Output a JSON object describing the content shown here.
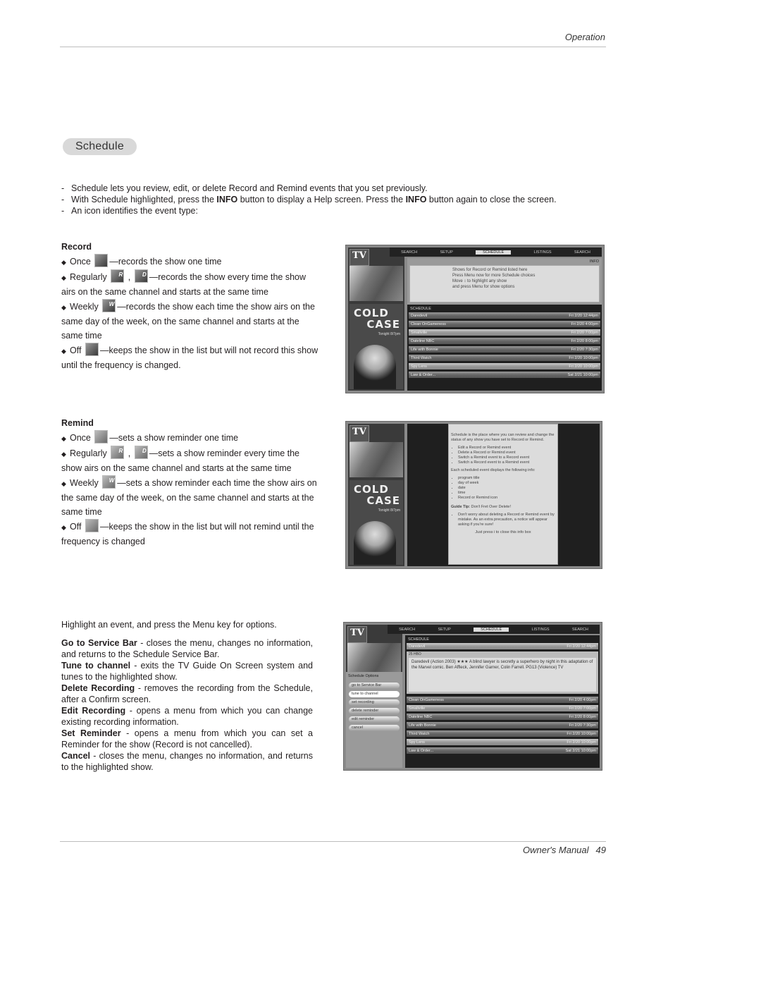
{
  "header": {
    "section_label": "Operation"
  },
  "title_pill": "Schedule",
  "intro": [
    {
      "parts": [
        {
          "t": "Schedule lets you review, edit, or delete Record and Remind events that you set previously."
        }
      ]
    },
    {
      "parts": [
        {
          "t": "With Schedule highlighted, press the "
        },
        {
          "t": "INFO",
          "b": true
        },
        {
          "t": " button to display a Help screen. Press the "
        },
        {
          "t": "INFO",
          "b": true
        },
        {
          "t": " button again to close the screen."
        }
      ]
    },
    {
      "parts": [
        {
          "t": "An icon identifies the event type:"
        }
      ]
    }
  ],
  "record": {
    "heading": "Record",
    "items": [
      {
        "label": "Once",
        "icons": [
          "record-once"
        ],
        "icon_letters": [
          ""
        ],
        "text": "—records the show one time"
      },
      {
        "label": "Regularly",
        "icons": [
          "record-regular-r",
          "record-regular-d"
        ],
        "icon_letters": [
          "R",
          "D"
        ],
        "text": "—records the show every time the show airs on the same channel and starts at the same time"
      },
      {
        "label": "Weekly",
        "icons": [
          "record-weekly"
        ],
        "icon_letters": [
          "W"
        ],
        "text": "—records the show each time the show airs on the same day of the week, on the same channel and starts at the same time"
      },
      {
        "label": "Off",
        "icons": [
          "record-off"
        ],
        "icon_letters": [
          ""
        ],
        "text": "—keeps the show in the list but will not record this show until the frequency is changed."
      }
    ]
  },
  "remind": {
    "heading": "Remind",
    "items": [
      {
        "label": "Once",
        "icons": [
          "remind-once"
        ],
        "icon_letters": [
          ""
        ],
        "text": "—sets a show reminder one time"
      },
      {
        "label": "Regularly",
        "icons": [
          "remind-regular-r",
          "remind-regular-d"
        ],
        "icon_letters": [
          "R",
          "D"
        ],
        "text": "—sets a show reminder every time the show airs on the same channel and starts at the same time"
      },
      {
        "label": "Weekly",
        "icons": [
          "remind-weekly"
        ],
        "icon_letters": [
          "W"
        ],
        "text": "—sets a show reminder each time the show airs on the same day of the week, on the same channel and starts at the same time"
      },
      {
        "label": "Off",
        "icons": [
          "remind-off"
        ],
        "icon_letters": [
          ""
        ],
        "text": "—keeps the show in the list but will not remind until the frequency is changed"
      }
    ]
  },
  "options": {
    "lead": "Highlight an event, and press the Menu key for options.",
    "items": [
      {
        "term": "Go to Service Bar",
        "desc": " - closes the menu, changes no information, and returns to the Schedule Service Bar."
      },
      {
        "term": "Tune to channel",
        "desc": " - exits the  TV Guide On Screen system and tunes to the highlighted show."
      },
      {
        "term": "Delete Recording",
        "desc": " - removes the recording from the Schedule, after a Confirm screen."
      },
      {
        "term": "Edit Recording",
        "desc": " - opens a menu from which you can change existing recording information."
      },
      {
        "term": "Set Reminder",
        "desc": " - opens a menu from which you can set a Reminder for the show (Record is not cancelled)."
      },
      {
        "term": "Cancel",
        "desc": " - closes the menu, changes no information, and returns to the highlighted show."
      }
    ]
  },
  "tv": {
    "logo": "TV",
    "ad_line1": "COLD",
    "ad_line2": "CASE",
    "ad_tune": "Tonight 8/7pm",
    "nav": [
      "SEARCH",
      "SETUP",
      "SCHEDULE",
      "LISTINGS",
      "SEARCH"
    ],
    "nav_active": "SCHEDULE",
    "info_label": "INFO",
    "schedule_header": "SCHEDULE",
    "help1": [
      "Shows for Record or Remind listed here",
      "Press Menu now for more Schedule choices",
      "Move ↕ to highlight any show",
      "and press Menu for show options"
    ],
    "rows": [
      {
        "title": "Daredevil",
        "time": "Fri 2/20  12:44pm",
        "hl": false
      },
      {
        "title": "Clean OnGameness",
        "time": "Fri 2/20   4:00pm",
        "hl": false
      },
      {
        "title": "Smallville",
        "time": "Fri 2/20   7:00pm",
        "hl": true
      },
      {
        "title": "Dateline NBC",
        "time": "Fri 2/20   8:00pm",
        "hl": false
      },
      {
        "title": "Life with Bonnie",
        "time": "Fri 2/20   7:30pm",
        "hl": false
      },
      {
        "title": "Third Watch",
        "time": "Fri 2/20  10:00pm",
        "hl": false
      },
      {
        "title": "Spy Lens",
        "time": "Fri 2/20  10:00pm",
        "hl": true
      },
      {
        "title": "Law & Order...",
        "time": "Sat 2/21  10:00pm",
        "hl": false
      }
    ],
    "help2": {
      "intro": "Schedule is the place where you can review and change the status of any show you have set to Record or Remind.",
      "bullets1": [
        "Edit a Record or Remind event",
        "Delete a Record or Remind event",
        "Switch a Remind event to a Record event",
        "Switch a Record event to a Remind event"
      ],
      "mid": "Each scheduled event displays the following info:",
      "bullets2": [
        "program title",
        "day of week",
        "date",
        "time",
        "Record or Remind icon"
      ],
      "tip_label": "Guide Tip:",
      "tip_title": " Don't Fret Over Delete!",
      "tip_bullet": "Don't worry about deleting a Record or Remind event by mistake. As an extra precaution, a notice will appear asking if you're sure!",
      "close": "Just press i to close this info box"
    },
    "screen3": {
      "selected_title": "Daredevil",
      "selected_time": "Fri 2/20  12:44pm",
      "channel": "25 HBO",
      "desc": "Daredevil (Action 2003) ★★★ A blind lawyer is secretly a superhero by night in this adaptation of the Marvel comic. Ben Affleck, Jennifer Garner, Colin Farrell. PG13 (Violence) TV",
      "menu_title": "Schedule Options",
      "menu": [
        "go to Service Bar",
        "tune to channel",
        "set recording",
        "delete reminder",
        "edit reminder",
        "cancel"
      ],
      "menu_active": 1
    }
  },
  "footer": {
    "label": "Owner's Manual",
    "page": "49"
  }
}
